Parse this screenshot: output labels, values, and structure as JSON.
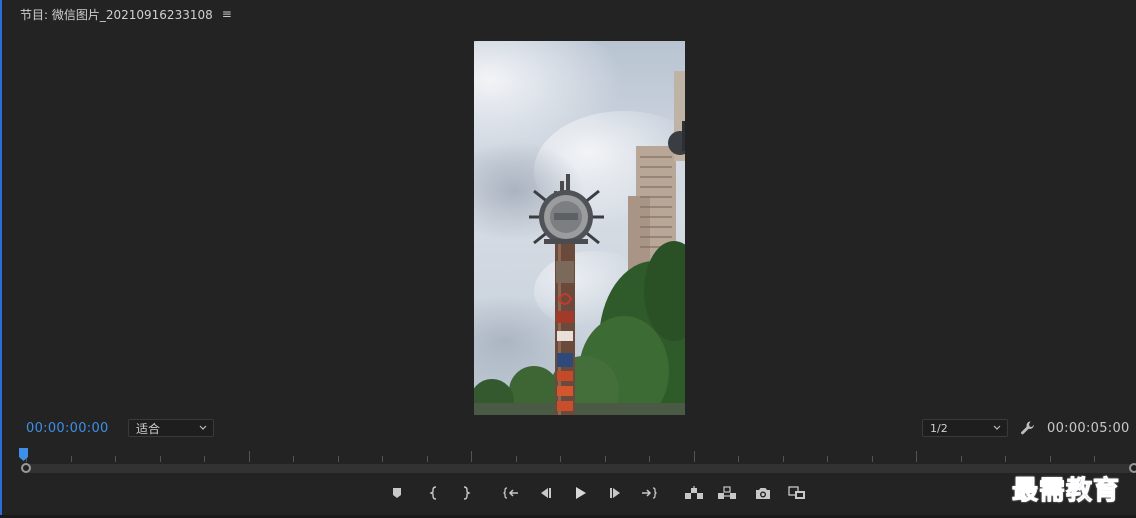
{
  "panel": {
    "title": "节目: 微信图片_20210916233108"
  },
  "controls": {
    "current_timecode": "00:00:00:00",
    "fit_select_value": "适合",
    "resolution_select_value": "1/2",
    "duration_timecode": "00:00:05:00"
  },
  "icons": {
    "panel_menu": "hamburger-menu-icon",
    "fit_dropdown": "chevron-down-icon",
    "res_dropdown": "chevron-down-icon",
    "settings": "wrench-icon",
    "playhead": "playhead-icon"
  },
  "transport_buttons": [
    {
      "name": "add-marker-button",
      "icon": "marker-icon"
    },
    {
      "name": "mark-in-button",
      "icon": "mark-in-icon"
    },
    {
      "name": "mark-out-button",
      "icon": "mark-out-icon"
    },
    {
      "name": "go-to-in-button",
      "icon": "go-to-in-icon"
    },
    {
      "name": "step-back-button",
      "icon": "step-back-icon"
    },
    {
      "name": "play-button",
      "icon": "play-icon"
    },
    {
      "name": "step-forward-button",
      "icon": "step-forward-icon"
    },
    {
      "name": "go-to-out-button",
      "icon": "go-to-out-icon"
    },
    {
      "name": "lift-button",
      "icon": "lift-icon"
    },
    {
      "name": "extract-button",
      "icon": "extract-icon"
    },
    {
      "name": "export-frame-button",
      "icon": "camera-icon"
    },
    {
      "name": "comparison-view-button",
      "icon": "comparison-icon"
    }
  ],
  "watermark": {
    "text": "最需教育"
  },
  "colors": {
    "background": "#232323",
    "accent_timecode": "#3d8fe8",
    "watermark": "#1f3fc0"
  }
}
